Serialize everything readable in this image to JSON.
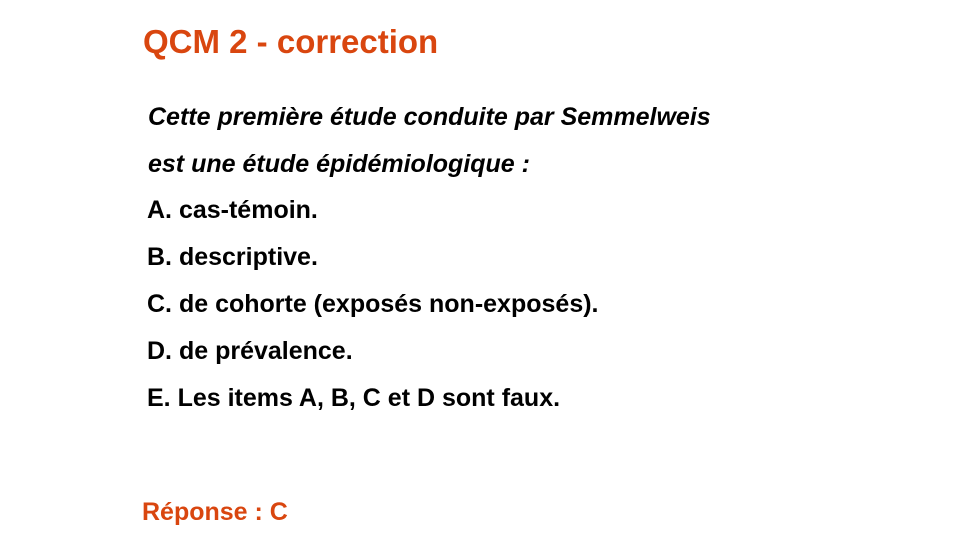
{
  "title": "QCM 2 - correction",
  "question": {
    "lines": [
      "Cette première étude conduite par Semmelweis",
      "est une étude épidémiologique :"
    ]
  },
  "options": [
    "A. cas-témoin.",
    "B. descriptive.",
    "C. de cohorte (exposés non-exposés).",
    "D. de prévalence.",
    "E. Les items A, B, C et D sont faux."
  ],
  "answer": "Réponse : C",
  "colors": {
    "accent": "#d9460f",
    "text": "#000000",
    "background": "#ffffff"
  }
}
